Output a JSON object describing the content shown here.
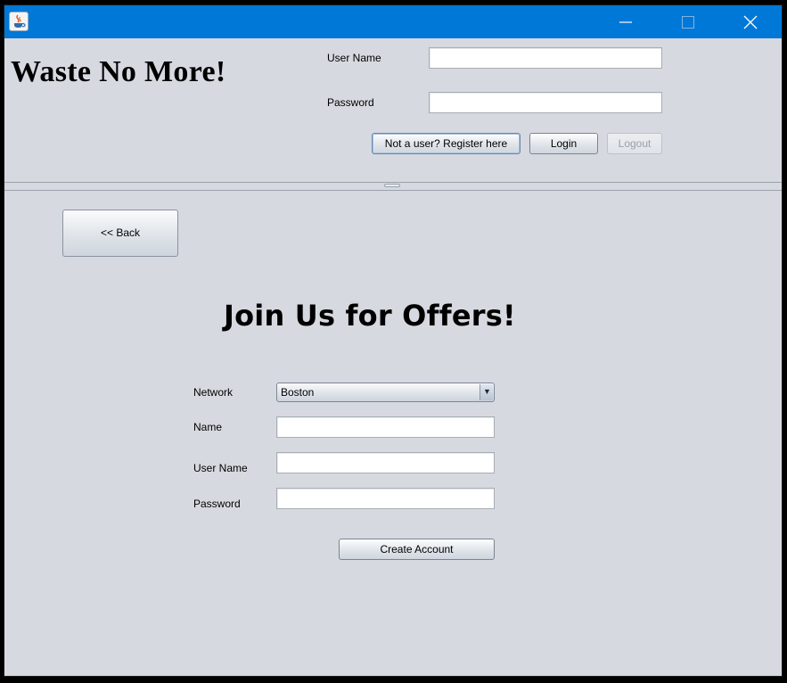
{
  "window": {
    "controls": {
      "minimize_icon": "minimize-icon",
      "maximize_icon": "maximize-icon",
      "close_icon": "close-icon"
    },
    "accent_color": "#0078d7"
  },
  "header": {
    "brand": "Waste No More!",
    "username_label": "User Name",
    "username_value": "",
    "password_label": "Password",
    "password_value": "",
    "register_button": "Not a user? Register here",
    "login_button": "Login",
    "logout_button": "Logout"
  },
  "register": {
    "back_button": "<< Back",
    "heading": "Join Us for Offers!",
    "network_label": "Network",
    "network_selected": "Boston",
    "name_label": "Name",
    "name_value": "",
    "username_label": "User Name",
    "username_value": "",
    "password_label": "Password",
    "password_value": "",
    "create_button": "Create Account"
  }
}
